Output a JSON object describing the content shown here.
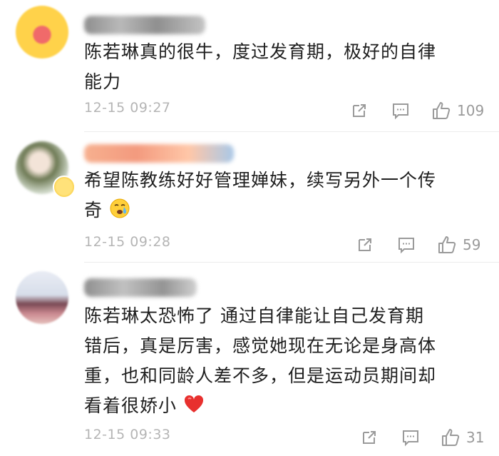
{
  "comments": [
    {
      "text_lines": [
        "陈若琳真的很牛，度过发育期，极好的自律",
        "能力"
      ],
      "time": "12-15 09:27",
      "likes": "109"
    },
    {
      "text_lines": [
        "希望陈教练好好管理婵妹，续写另外一个传",
        "奇"
      ],
      "time": "12-15 09:28",
      "likes": "59"
    },
    {
      "text_lines": [
        "陈若琳太恐怖了  通过自律能让自己发育期",
        "错后，真是厉害，感觉她现在无论是身高体",
        "重，也和同龄人差不多，但是运动员期间却",
        "看着很娇小"
      ],
      "time": "12-15 09:33",
      "likes": "31"
    }
  ],
  "colors": {
    "text": "#1f1f1f",
    "meta": "#b5b5b5",
    "icon": "#9a9a9a",
    "heart": "#e8302e"
  },
  "icons": [
    "share-icon",
    "comment-icon",
    "like-thumb-icon",
    "weep-emoji-icon",
    "red-heart-icon"
  ]
}
